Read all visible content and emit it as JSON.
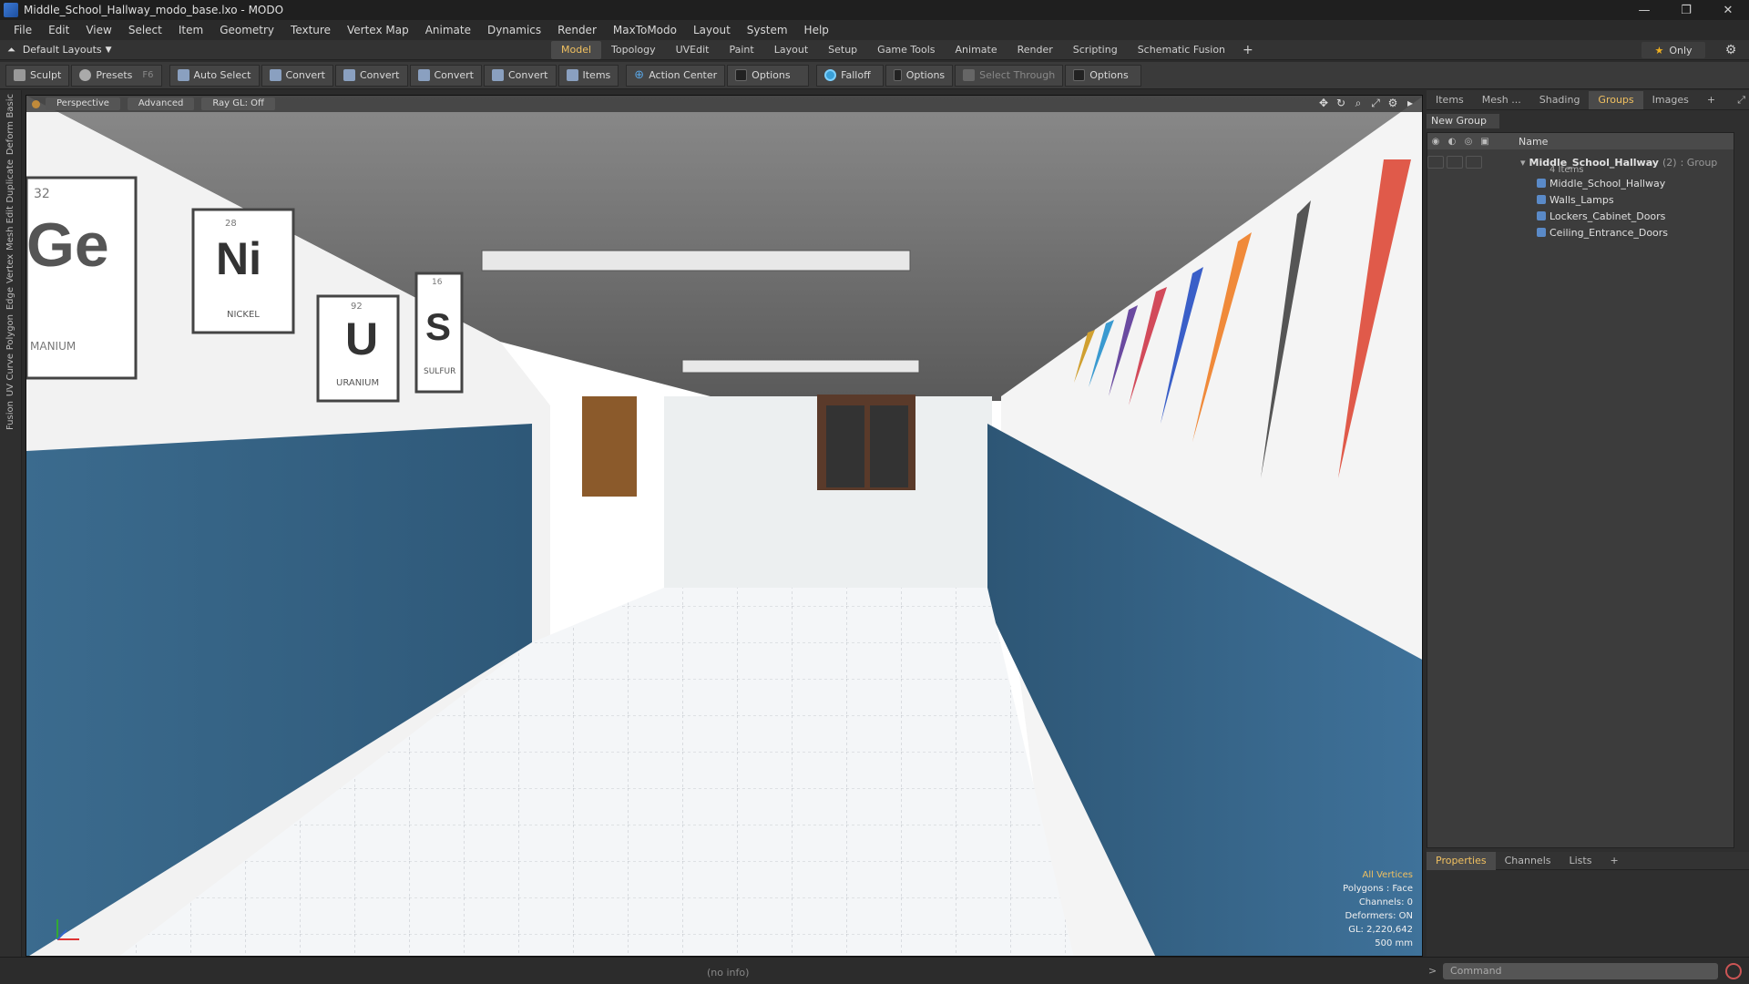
{
  "window": {
    "title": "Middle_School_Hallway_modo_base.lxo - MODO",
    "controls": [
      "—",
      "❐",
      "✕"
    ]
  },
  "menu": [
    "File",
    "Edit",
    "View",
    "Select",
    "Item",
    "Geometry",
    "Texture",
    "Vertex Map",
    "Animate",
    "Dynamics",
    "Render",
    "MaxToModo",
    "Layout",
    "System",
    "Help"
  ],
  "layouts": {
    "label": "Default Layouts",
    "tabs": [
      "Model",
      "Topology",
      "UVEdit",
      "Paint",
      "Layout",
      "Setup",
      "Game Tools",
      "Animate",
      "Render",
      "Scripting",
      "Schematic Fusion"
    ],
    "active": "Model",
    "only": "Only"
  },
  "toolbar": [
    {
      "label": "Sculpt",
      "icon": "sculpt-icon"
    },
    {
      "label": "Presets",
      "icon": "presets-icon",
      "hotkey": "F6"
    },
    {
      "label": "Auto Select",
      "icon": "auto-select-icon"
    },
    {
      "label": "Convert",
      "icon": "convert-vertex-icon"
    },
    {
      "label": "Convert",
      "icon": "convert-edge-icon"
    },
    {
      "label": "Convert",
      "icon": "convert-polygon-icon"
    },
    {
      "label": "Convert",
      "icon": "convert-material-icon"
    },
    {
      "label": "Items",
      "icon": "items-icon"
    },
    {
      "label": "Action Center",
      "icon": "action-center-icon"
    },
    {
      "label": "Options",
      "icon": "options-checkbox"
    },
    {
      "label": "Falloff",
      "icon": "falloff-icon"
    },
    {
      "label": "Options",
      "icon": "options-checkbox"
    },
    {
      "label": "Select Through",
      "icon": "select-through-icon"
    },
    {
      "label": "Options",
      "icon": "options-checkbox"
    }
  ],
  "leftstrip": [
    "Basic",
    "Deform",
    "Duplicate",
    "Mesh Edit",
    "Vertex",
    "Edge",
    "Polygon",
    "Curve",
    "UV",
    "Fusion"
  ],
  "viewport": {
    "buttons": [
      "Perspective",
      "Advanced",
      "Ray GL: Off"
    ],
    "info": {
      "line1": "All Vertices",
      "line2": "Polygons : Face",
      "line3": "Channels: 0",
      "line4": "Deformers: ON",
      "line5": "GL: 2,220,642",
      "line6": "500 mm"
    },
    "elements": [
      "Ge",
      "Ni",
      "NICKEL",
      "U",
      "URANIUM",
      "S",
      "SULFUR",
      "28",
      "92",
      "16",
      "32",
      "MANIUM"
    ]
  },
  "rightpanel": {
    "tabs": [
      "Items",
      "Mesh ...",
      "Shading",
      "Groups",
      "Images"
    ],
    "active": "Groups",
    "newgroup": "New Group",
    "header": "Name",
    "group": {
      "name": "Middle_School_Hallway",
      "count": "(2)",
      "type": ": Group",
      "sub": "4 Items"
    },
    "children": [
      "Middle_School_Hallway",
      "Walls_Lamps",
      "Lockers_Cabinet_Doors",
      "Ceiling_Entrance_Doors"
    ],
    "ptabs": [
      "Properties",
      "Channels",
      "Lists"
    ],
    "pactive": "Properties"
  },
  "status": {
    "noinfo": "(no info)",
    "command": "Command"
  }
}
